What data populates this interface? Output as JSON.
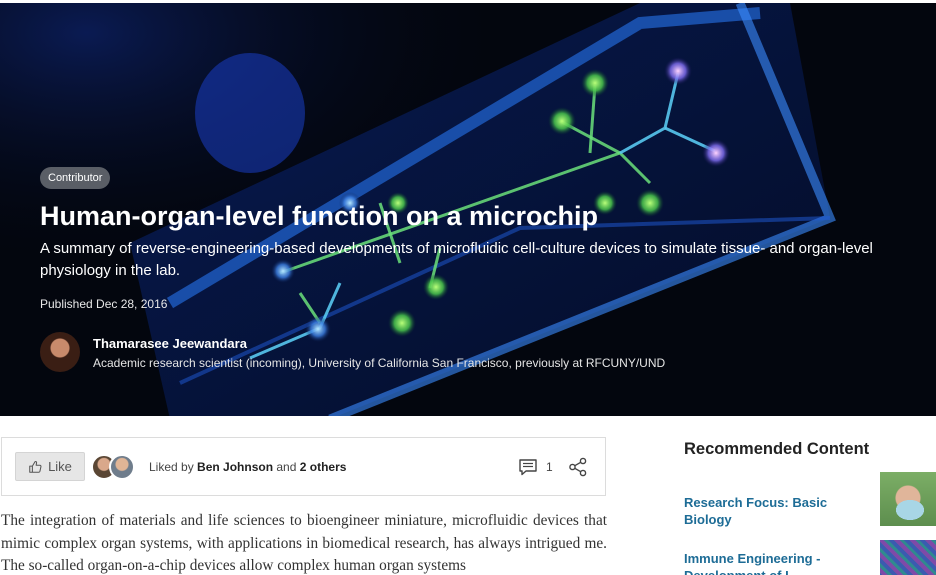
{
  "hero": {
    "badge": "Contributor",
    "title": "Human-organ-level function on a microchip",
    "summary": "A summary of reverse-engineering-based developments of microfluidic cell-culture devices to simulate tissue- and organ-level physiology in the lab.",
    "published": "Published Dec 28, 2016",
    "author": {
      "name": "Thamarasee Jeewandara",
      "role": "Academic research scientist (incoming), University of California San Francisco, previously at RFCUNY/UND"
    }
  },
  "social": {
    "like_label": "Like",
    "liked_prefix": "Liked by ",
    "liked_name": "Ben Johnson",
    "liked_mid": " and ",
    "liked_others": "2 others",
    "comment_count": "1"
  },
  "article": {
    "text": "The integration of materials and life sciences to bioengineer miniature, microfluidic devices that mimic complex organ systems, with applications in biomedical research, has always intrigued me. The so-called organ-on-a-chip devices allow complex human organ systems"
  },
  "sidebar": {
    "title": "Recommended Content",
    "items": [
      {
        "label": "Research Focus: Basic Biology"
      },
      {
        "label": "Immune Engineering - Development of I..."
      }
    ]
  },
  "colors": {
    "link": "#1d6c96",
    "hero_bg": "#04070f",
    "badge_bg": "#5a5e66"
  },
  "icons": [
    "thumbs-up-icon",
    "comment-icon",
    "share-icon"
  ]
}
